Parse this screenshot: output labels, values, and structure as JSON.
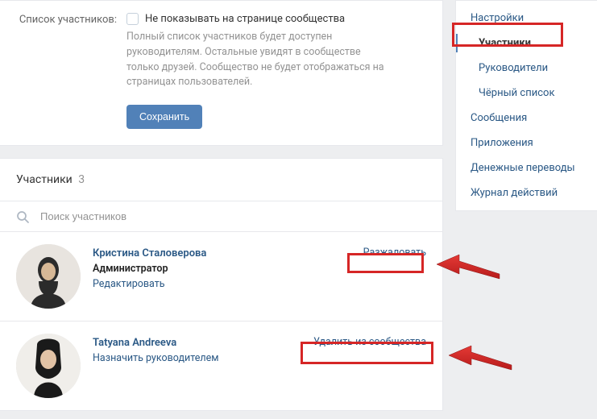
{
  "settings": {
    "label": "Список участников:",
    "checkbox_label": "Не показывать на странице сообщества",
    "description": "Полный список участников будет доступен руководителям. Остальные увидят в сообществе только друзей. Сообщество не будет отображаться на страницах пользователей.",
    "save": "Сохранить"
  },
  "members_section": {
    "title": "Участники",
    "count": "3",
    "search_placeholder": "Поиск участников"
  },
  "members": [
    {
      "name": "Кристина Сталоверова",
      "role": "Администратор",
      "edit": "Редактировать",
      "action": "Разжаловать"
    },
    {
      "name": "Tatyana Andreeva",
      "assign": "Назначить руководителем",
      "action": "Удалить из сообщества"
    }
  ],
  "sidebar": {
    "items": [
      "Настройки",
      "Участники",
      "Руководители",
      "Чёрный список",
      "Сообщения",
      "Приложения",
      "Денежные переводы",
      "Журнал действий"
    ]
  }
}
